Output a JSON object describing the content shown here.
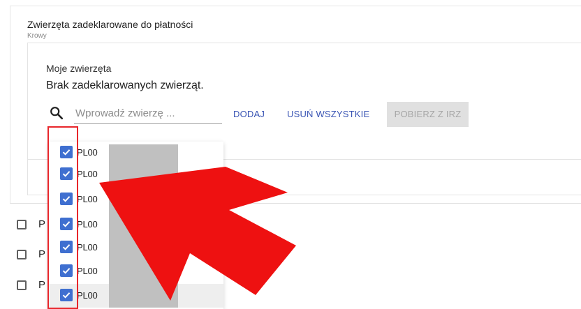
{
  "section": {
    "title": "Zwierzęta zadeklarowane do płatności",
    "subtitle": "Krowy"
  },
  "panel": {
    "my_animals_label": "Moje zwierzęta",
    "empty_message": "Brak zadeklarowanych zwierząt."
  },
  "search": {
    "icon": "search-icon",
    "placeholder": "Wprowadź zwierzę ..."
  },
  "actions": {
    "add_label": "DODAJ",
    "remove_all_label": "USUŃ WSZYSTKIE",
    "fetch_label": "POBIERZ Z IRZ"
  },
  "dropdown": {
    "options": [
      {
        "label": "PL00",
        "checked": true
      },
      {
        "label": "PL00",
        "checked": true
      },
      {
        "label": "PL00",
        "checked": true
      },
      {
        "label": "PL00",
        "checked": true
      },
      {
        "label": "PL00",
        "checked": true
      },
      {
        "label": "PL00",
        "checked": true
      },
      {
        "label": "PL00",
        "checked": true
      }
    ]
  },
  "background_list": {
    "items": [
      {
        "label": "P",
        "checked": false
      },
      {
        "label": "P",
        "checked": false
      },
      {
        "label": "P",
        "checked": false
      }
    ]
  },
  "colors": {
    "accent": "#3a55b4",
    "checkbox": "#3f6fd0",
    "annotation": "#ee1111",
    "highlight_border": "#e8262b"
  }
}
